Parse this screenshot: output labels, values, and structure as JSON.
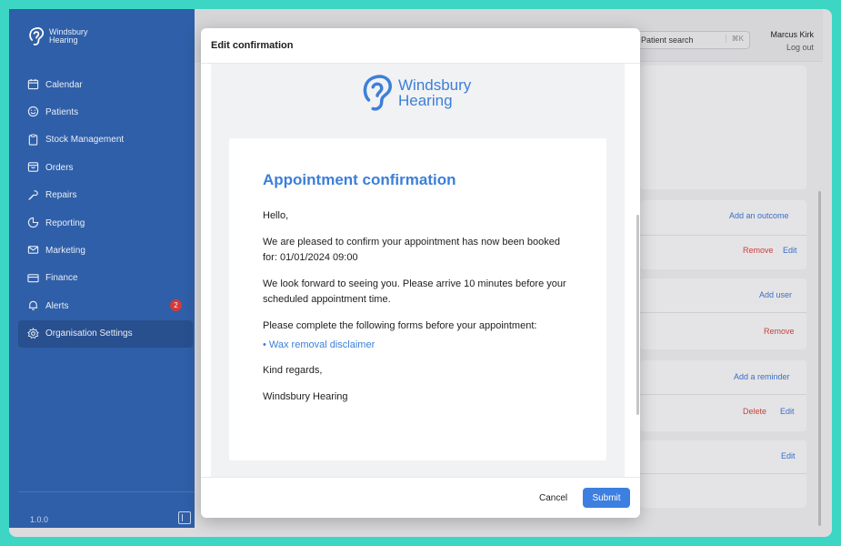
{
  "app": {
    "brand_line1": "Windsbury",
    "brand_line2": "Hearing",
    "version": "1.0.0"
  },
  "sidebar": {
    "items": [
      {
        "label": "Calendar",
        "icon": "calendar-icon"
      },
      {
        "label": "Patients",
        "icon": "smile-icon"
      },
      {
        "label": "Stock Management",
        "icon": "clipboard-icon"
      },
      {
        "label": "Orders",
        "icon": "box-icon"
      },
      {
        "label": "Repairs",
        "icon": "wrench-icon"
      },
      {
        "label": "Reporting",
        "icon": "pie-chart-icon"
      },
      {
        "label": "Marketing",
        "icon": "mail-icon"
      },
      {
        "label": "Finance",
        "icon": "credit-card-icon"
      },
      {
        "label": "Alerts",
        "icon": "bell-icon",
        "badge": "2"
      },
      {
        "label": "Organisation Settings",
        "icon": "gear-icon",
        "active": true
      }
    ]
  },
  "header": {
    "search_label": "Patient search",
    "search_shortcut": "⌘K",
    "user_name": "Marcus Kirk",
    "logout_label": "Log out"
  },
  "background_actions": {
    "add_outcome": "Add an outcome",
    "remove1": "Remove",
    "edit1": "Edit",
    "add_user": "Add user",
    "remove2": "Remove",
    "add_reminder": "Add a reminder",
    "delete": "Delete",
    "edit2": "Edit",
    "edit3": "Edit"
  },
  "modal": {
    "title": "Edit confirmation",
    "logo_line1": "Windsbury",
    "logo_line2": "Hearing",
    "email_title": "Appointment confirmation",
    "greeting": "Hello,",
    "p1": "We are pleased to confirm your appointment has now been booked for: 01/01/2024 09:00",
    "p2": "We look forward to seeing you. Please arrive 10 minutes before your scheduled appointment time.",
    "p3": "Please complete the following forms before your appointment:",
    "form_link": "• Wax removal disclaimer",
    "closing": "Kind regards,",
    "signature": "Windsbury Hearing",
    "cancel_label": "Cancel",
    "submit_label": "Submit"
  },
  "colors": {
    "sidebar": "#2f5fa8",
    "accent": "#3c7fd8",
    "danger": "#c8413d",
    "frame": "#3dd6c4"
  }
}
